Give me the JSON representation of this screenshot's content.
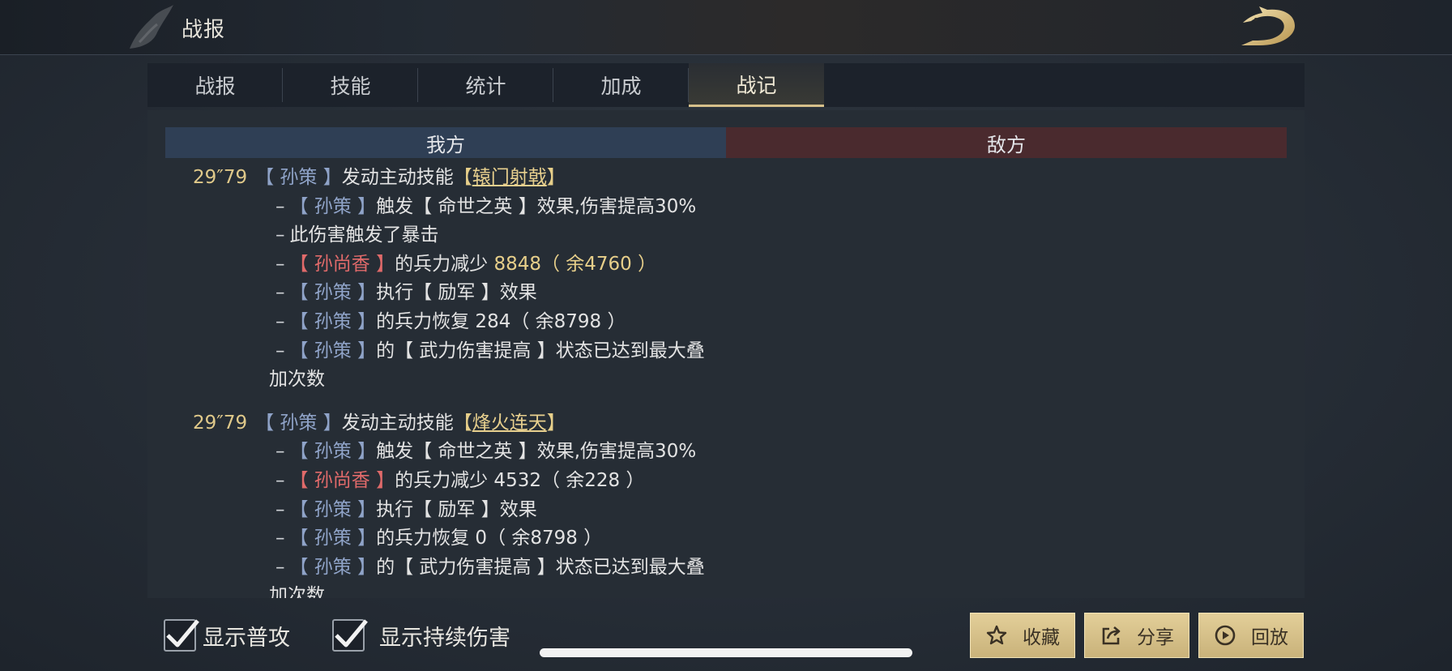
{
  "header": {
    "title": "战报",
    "logo_icon": "dragon-logo-icon"
  },
  "tabs": [
    {
      "label": "战报",
      "active": false
    },
    {
      "label": "技能",
      "active": false
    },
    {
      "label": "统计",
      "active": false
    },
    {
      "label": "加成",
      "active": false
    },
    {
      "label": "战记",
      "active": true
    }
  ],
  "sides": {
    "ally": "我方",
    "enemy": "敌方"
  },
  "colors": {
    "ally": "#8fa3c8",
    "enemy": "#e06a6a",
    "gold": "#e7cf8a",
    "active_tab_underline": "#d6c08a"
  },
  "log": [
    {
      "time": "29″79",
      "actor": "【 孙策 】",
      "action": "发动主动技能",
      "skill_open": "【",
      "skill": "辕门射戟",
      "skill_close": "】",
      "lines": [
        {
          "parts": [
            {
              "t": "【 孙策 】",
              "c": "ally"
            },
            {
              "t": "触发【 命世之英 】效果,伤害提高30%",
              "c": ""
            }
          ]
        },
        {
          "parts": [
            {
              "t": "此伤害触发了暴击",
              "c": ""
            }
          ]
        },
        {
          "parts": [
            {
              "t": "【 孙尚香 】",
              "c": "enemy"
            },
            {
              "t": "的兵力减少 ",
              "c": ""
            },
            {
              "t": "8848（ 余4760 ）",
              "c": "gold"
            }
          ]
        },
        {
          "parts": [
            {
              "t": "【 孙策 】",
              "c": "ally"
            },
            {
              "t": "执行【 励军 】效果",
              "c": ""
            }
          ]
        },
        {
          "parts": [
            {
              "t": "【 孙策 】",
              "c": "ally"
            },
            {
              "t": "的兵力恢复 284（ 余8798 ）",
              "c": ""
            }
          ]
        },
        {
          "parts": [
            {
              "t": "【 孙策 】",
              "c": "ally"
            },
            {
              "t": "的【 武力伤害提高 】状态已达到最大叠",
              "c": ""
            }
          ]
        }
      ],
      "wrap": "加次数"
    },
    {
      "time": "29″79",
      "actor": "【 孙策 】",
      "action": "发动主动技能",
      "skill_open": "【",
      "skill": "烽火连天",
      "skill_close": "】",
      "lines": [
        {
          "parts": [
            {
              "t": "【 孙策 】",
              "c": "ally"
            },
            {
              "t": "触发【 命世之英 】效果,伤害提高30%",
              "c": ""
            }
          ]
        },
        {
          "parts": [
            {
              "t": "【 孙尚香 】",
              "c": "enemy"
            },
            {
              "t": "的兵力减少 4532（ 余228 ）",
              "c": ""
            }
          ]
        },
        {
          "parts": [
            {
              "t": "【 孙策 】",
              "c": "ally"
            },
            {
              "t": "执行【 励军 】效果",
              "c": ""
            }
          ]
        },
        {
          "parts": [
            {
              "t": "【 孙策 】",
              "c": "ally"
            },
            {
              "t": "的兵力恢复 0（ 余8798 ）",
              "c": ""
            }
          ]
        },
        {
          "parts": [
            {
              "t": "【 孙策 】",
              "c": "ally"
            },
            {
              "t": "的【 武力伤害提高 】状态已达到最大叠",
              "c": ""
            }
          ]
        }
      ],
      "wrap": "加次数"
    }
  ],
  "bottom": {
    "show_normal_attack": {
      "label": "显示普攻",
      "checked": true
    },
    "show_dot": {
      "label": "显示持续伤害",
      "checked": true
    },
    "favorite": {
      "label": "收藏",
      "icon": "star-icon"
    },
    "share": {
      "label": "分享",
      "icon": "share-icon"
    },
    "replay": {
      "label": "回放",
      "icon": "play-icon"
    }
  }
}
